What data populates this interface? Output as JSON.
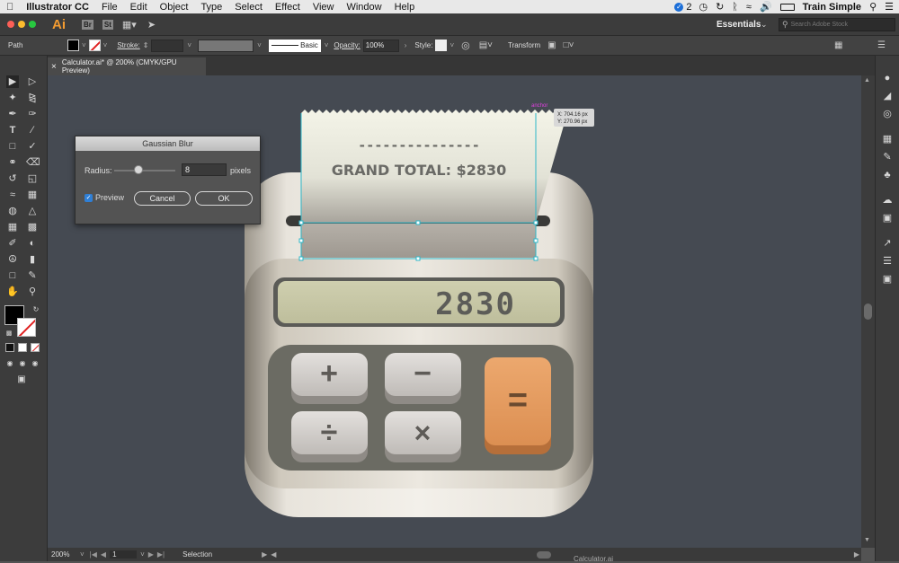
{
  "menubar": {
    "apple_icon": "apple-icon",
    "app_name": "Illustrator CC",
    "menus": [
      "File",
      "Edit",
      "Object",
      "Type",
      "Select",
      "Effect",
      "View",
      "Window",
      "Help"
    ],
    "notifications": "2",
    "user": "Train Simple"
  },
  "appbar": {
    "logo": "Ai",
    "br": "Br",
    "st": "St",
    "workspace": "Essentials",
    "search_placeholder": "Search Adobe Stock"
  },
  "control": {
    "selection_type": "Path",
    "stroke_label": "Stroke:",
    "brush": "Basic",
    "opacity_label": "Opacity:",
    "opacity_value": "100%",
    "style_label": "Style:",
    "transform": "Transform"
  },
  "document": {
    "tab_title": "Calculator.ai* @ 200% (CMYK/GPU Preview)",
    "close": "×"
  },
  "receipt": {
    "dashes": "---------------",
    "total": "GRAND TOTAL: $2830"
  },
  "tooltip": {
    "anchor_label": "anchor",
    "x": "X: 704.16 px",
    "y": "Y: 270.96 px"
  },
  "calculator": {
    "display": "2830",
    "keys": [
      "+",
      "−",
      "÷",
      "×",
      "="
    ],
    "colors": {
      "body": "#d9d3c7",
      "display": "#c8c8a8",
      "keypad": "#6b6b63",
      "key": "#cfcbc8",
      "equals": "#e39a5e",
      "canvas": "#454a52"
    }
  },
  "dialog": {
    "title": "Gaussian Blur",
    "radius_label": "Radius:",
    "radius_value": "8",
    "unit": "pixels",
    "preview_label": "Preview",
    "preview_checked": true,
    "cancel": "Cancel",
    "ok": "OK"
  },
  "status": {
    "zoom": "200%",
    "artboard": "1",
    "tool": "Selection",
    "filename": "Calculator.ai"
  }
}
